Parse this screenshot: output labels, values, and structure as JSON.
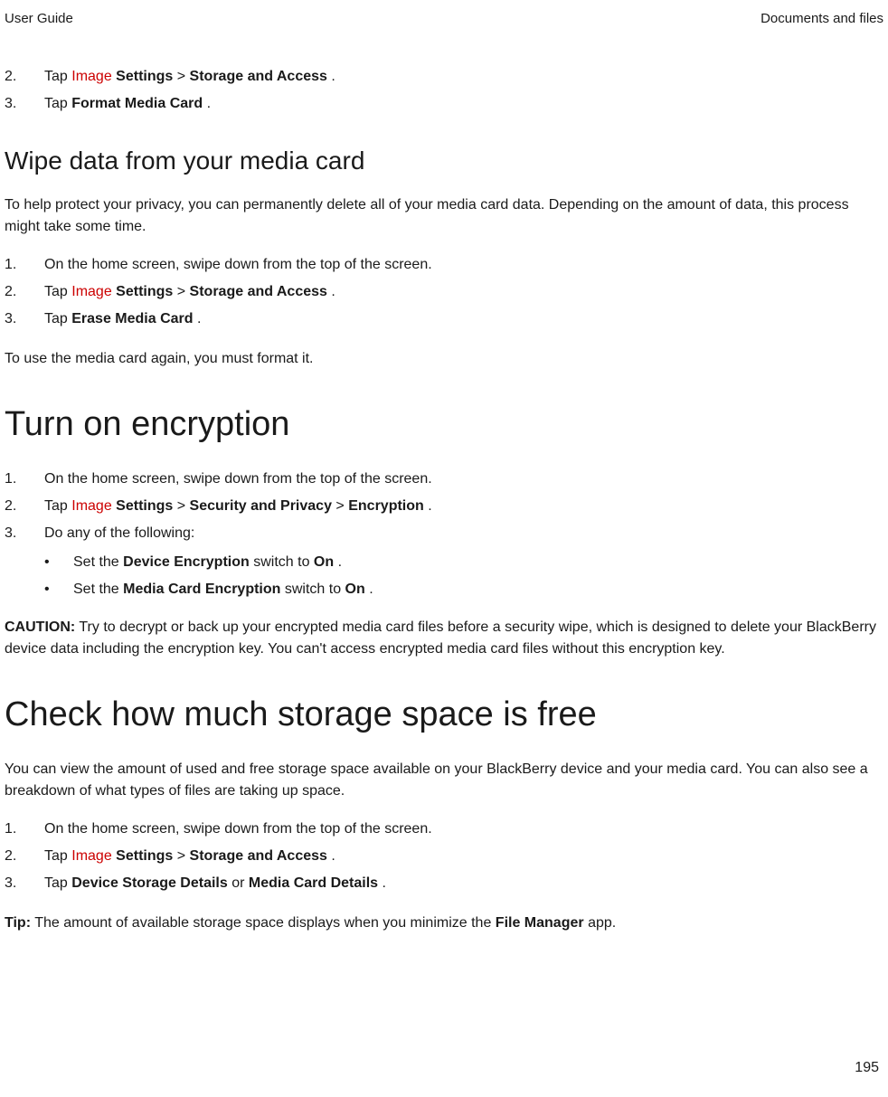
{
  "header": {
    "left": "User Guide",
    "right": "Documents and files"
  },
  "top_steps": {
    "s2": {
      "num": "2.",
      "pre": "Tap ",
      "img": "Image",
      "b1": "Settings",
      "sep": " > ",
      "b2": "Storage and Access",
      "post": "."
    },
    "s3": {
      "num": "3.",
      "pre": "Tap ",
      "b1": "Format Media Card",
      "post": "."
    }
  },
  "wipe": {
    "title": "Wipe data from your media card",
    "para": "To help protect your privacy, you can permanently delete all of your media card data. Depending on the amount of data, this process might take some time.",
    "s1": {
      "num": "1.",
      "text": "On the home screen, swipe down from the top of the screen."
    },
    "s2": {
      "num": "2.",
      "pre": "Tap ",
      "img": "Image",
      "b1": "Settings",
      "sep": " > ",
      "b2": "Storage and Access",
      "post": "."
    },
    "s3": {
      "num": "3.",
      "pre": "Tap ",
      "b1": "Erase Media Card",
      "post": "."
    },
    "after": "To use the media card again, you must format it."
  },
  "encryption": {
    "title": "Turn on encryption",
    "s1": {
      "num": "1.",
      "text": "On the home screen, swipe down from the top of the screen."
    },
    "s2": {
      "num": "2.",
      "pre": "Tap ",
      "img": "Image",
      "b1": "Settings",
      "sep1": " > ",
      "b2": "Security and Privacy",
      "sep2": " > ",
      "b3": "Encryption",
      "post": "."
    },
    "s3": {
      "num": "3.",
      "text": "Do any of the following:"
    },
    "sub1": {
      "bullet": "•",
      "pre": "Set the ",
      "b1": "Device Encryption",
      "mid": " switch to ",
      "b2": "On",
      "post": "."
    },
    "sub2": {
      "bullet": "•",
      "pre": "Set the ",
      "b1": "Media Card Encryption",
      "mid": " switch to ",
      "b2": "On",
      "post": "."
    },
    "caution": {
      "label": "CAUTION:",
      "text": " Try to decrypt or back up your encrypted media card files before a security wipe, which is designed to delete your BlackBerry device data including the encryption key. You can't access encrypted media card files without this encryption key."
    }
  },
  "storage": {
    "title": "Check how much storage space is free",
    "para": "You can view the amount of used and free storage space available on your BlackBerry device and your media card. You can also see a breakdown of what types of files are taking up space.",
    "s1": {
      "num": "1.",
      "text": "On the home screen, swipe down from the top of the screen."
    },
    "s2": {
      "num": "2.",
      "pre": "Tap ",
      "img": "Image",
      "b1": "Settings",
      "sep": " > ",
      "b2": "Storage and Access",
      "post": "."
    },
    "s3": {
      "num": "3.",
      "pre": "Tap ",
      "b1": "Device Storage Details",
      "mid": " or ",
      "b2": "Media Card Details",
      "post": "."
    },
    "tip": {
      "label": "Tip:",
      "pre": " The amount of available storage space displays when you minimize the ",
      "b1": "File Manager",
      "post": " app."
    }
  },
  "page_number": "195"
}
